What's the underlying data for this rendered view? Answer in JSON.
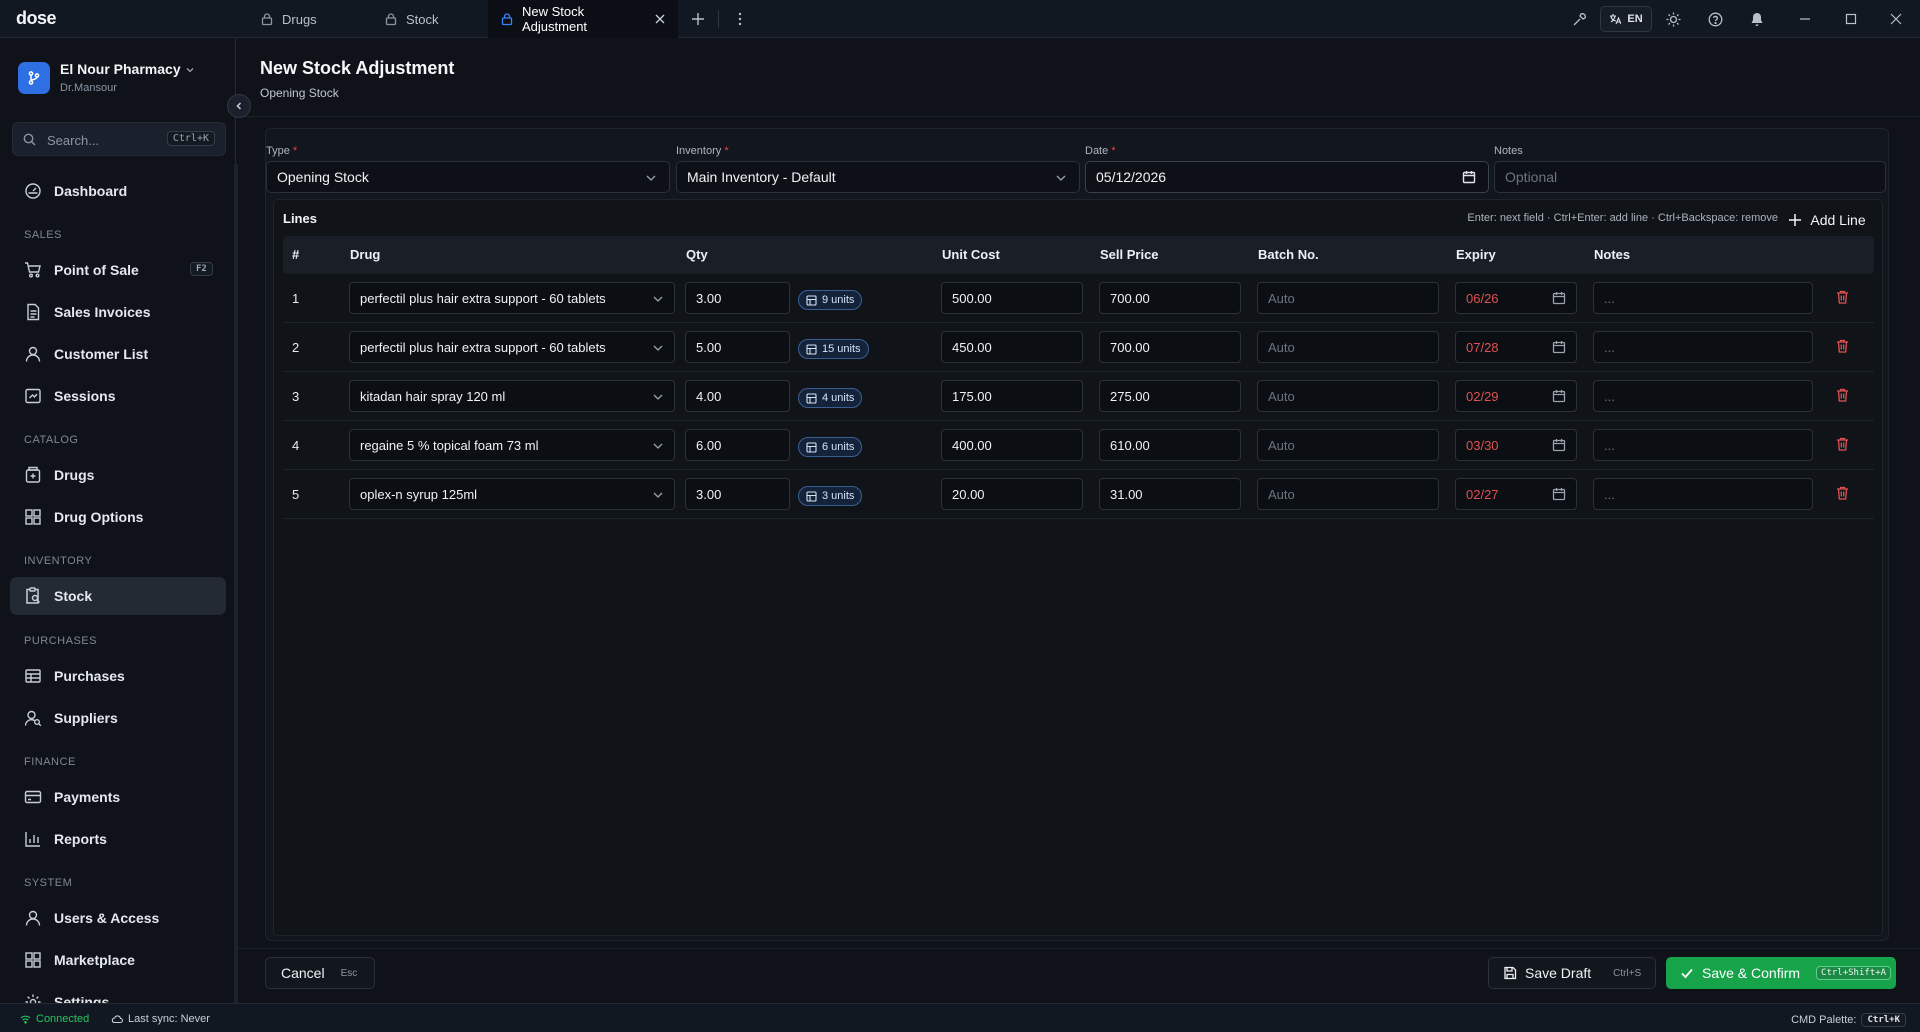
{
  "app": {
    "logo": "dose"
  },
  "tabs": [
    {
      "label": "Drugs"
    },
    {
      "label": "Stock"
    },
    {
      "label": "New Stock Adjustment"
    }
  ],
  "topbar": {
    "lang": "EN"
  },
  "workspace": {
    "name": "El Nour Pharmacy",
    "user": "Dr.Mansour"
  },
  "search": {
    "placeholder": "Search...",
    "shortcut": "Ctrl+K"
  },
  "nav": {
    "dashboard": "Dashboard",
    "sales_section": "SALES",
    "pos": "Point of Sale",
    "pos_key": "F2",
    "sales_invoices": "Sales Invoices",
    "customer_list": "Customer List",
    "sessions": "Sessions",
    "catalog_section": "CATALOG",
    "drugs": "Drugs",
    "drug_options": "Drug Options",
    "inventory_section": "INVENTORY",
    "stock": "Stock",
    "purchases_section": "PURCHASES",
    "purchases": "Purchases",
    "suppliers": "Suppliers",
    "finance_section": "FINANCE",
    "payments": "Payments",
    "reports": "Reports",
    "system_section": "SYSTEM",
    "users_access": "Users & Access",
    "marketplace": "Marketplace",
    "settings": "Settings"
  },
  "page": {
    "title": "New Stock Adjustment",
    "subtitle": "Opening Stock"
  },
  "form": {
    "type_label": "Type",
    "type_value": "Opening Stock",
    "inventory_label": "Inventory",
    "inventory_value": "Main Inventory - Default",
    "date_label": "Date",
    "date_value": "05/12/2026",
    "notes_label": "Notes",
    "notes_placeholder": "Optional",
    "required_mark": "*"
  },
  "lines": {
    "title": "Lines",
    "hint": "Enter: next field · Ctrl+Enter: add line · Ctrl+Backspace: remove",
    "add_label": "Add Line",
    "columns": [
      "#",
      "Drug",
      "Qty",
      "Unit Cost",
      "Sell Price",
      "Batch No.",
      "Expiry",
      "Notes"
    ],
    "batch_placeholder": "Auto",
    "notes_placeholder": "...",
    "rows": [
      {
        "n": "1",
        "drug": "perfectil plus hair extra support - 60 tablets",
        "qty": "3.00",
        "units": "9 units",
        "cost": "500.00",
        "price": "700.00",
        "expiry": "06/26"
      },
      {
        "n": "2",
        "drug": "perfectil plus hair extra support - 60 tablets",
        "qty": "5.00",
        "units": "15 units",
        "cost": "450.00",
        "price": "700.00",
        "expiry": "07/28"
      },
      {
        "n": "3",
        "drug": "kitadan hair spray 120 ml",
        "qty": "4.00",
        "units": "4 units",
        "cost": "175.00",
        "price": "275.00",
        "expiry": "02/29"
      },
      {
        "n": "4",
        "drug": "regaine 5 % topical foam 73 ml",
        "qty": "6.00",
        "units": "6 units",
        "cost": "400.00",
        "price": "610.00",
        "expiry": "03/30"
      },
      {
        "n": "5",
        "drug": "oplex-n syrup 125ml",
        "qty": "3.00",
        "units": "3 units",
        "cost": "20.00",
        "price": "31.00",
        "expiry": "02/27"
      }
    ]
  },
  "footer": {
    "cancel": "Cancel",
    "cancel_key": "Esc",
    "save_draft": "Save Draft",
    "save_draft_key": "Ctrl+S",
    "confirm": "Save & Confirm",
    "confirm_key": "Ctrl+Shift+A"
  },
  "status": {
    "connected": "Connected",
    "sync": "Last sync: Never",
    "palette": "CMD Palette:",
    "palette_key": "Ctrl+K"
  },
  "colors": {
    "accent": "#2f6fe4",
    "confirm": "#16a34a",
    "danger": "#e05252"
  }
}
